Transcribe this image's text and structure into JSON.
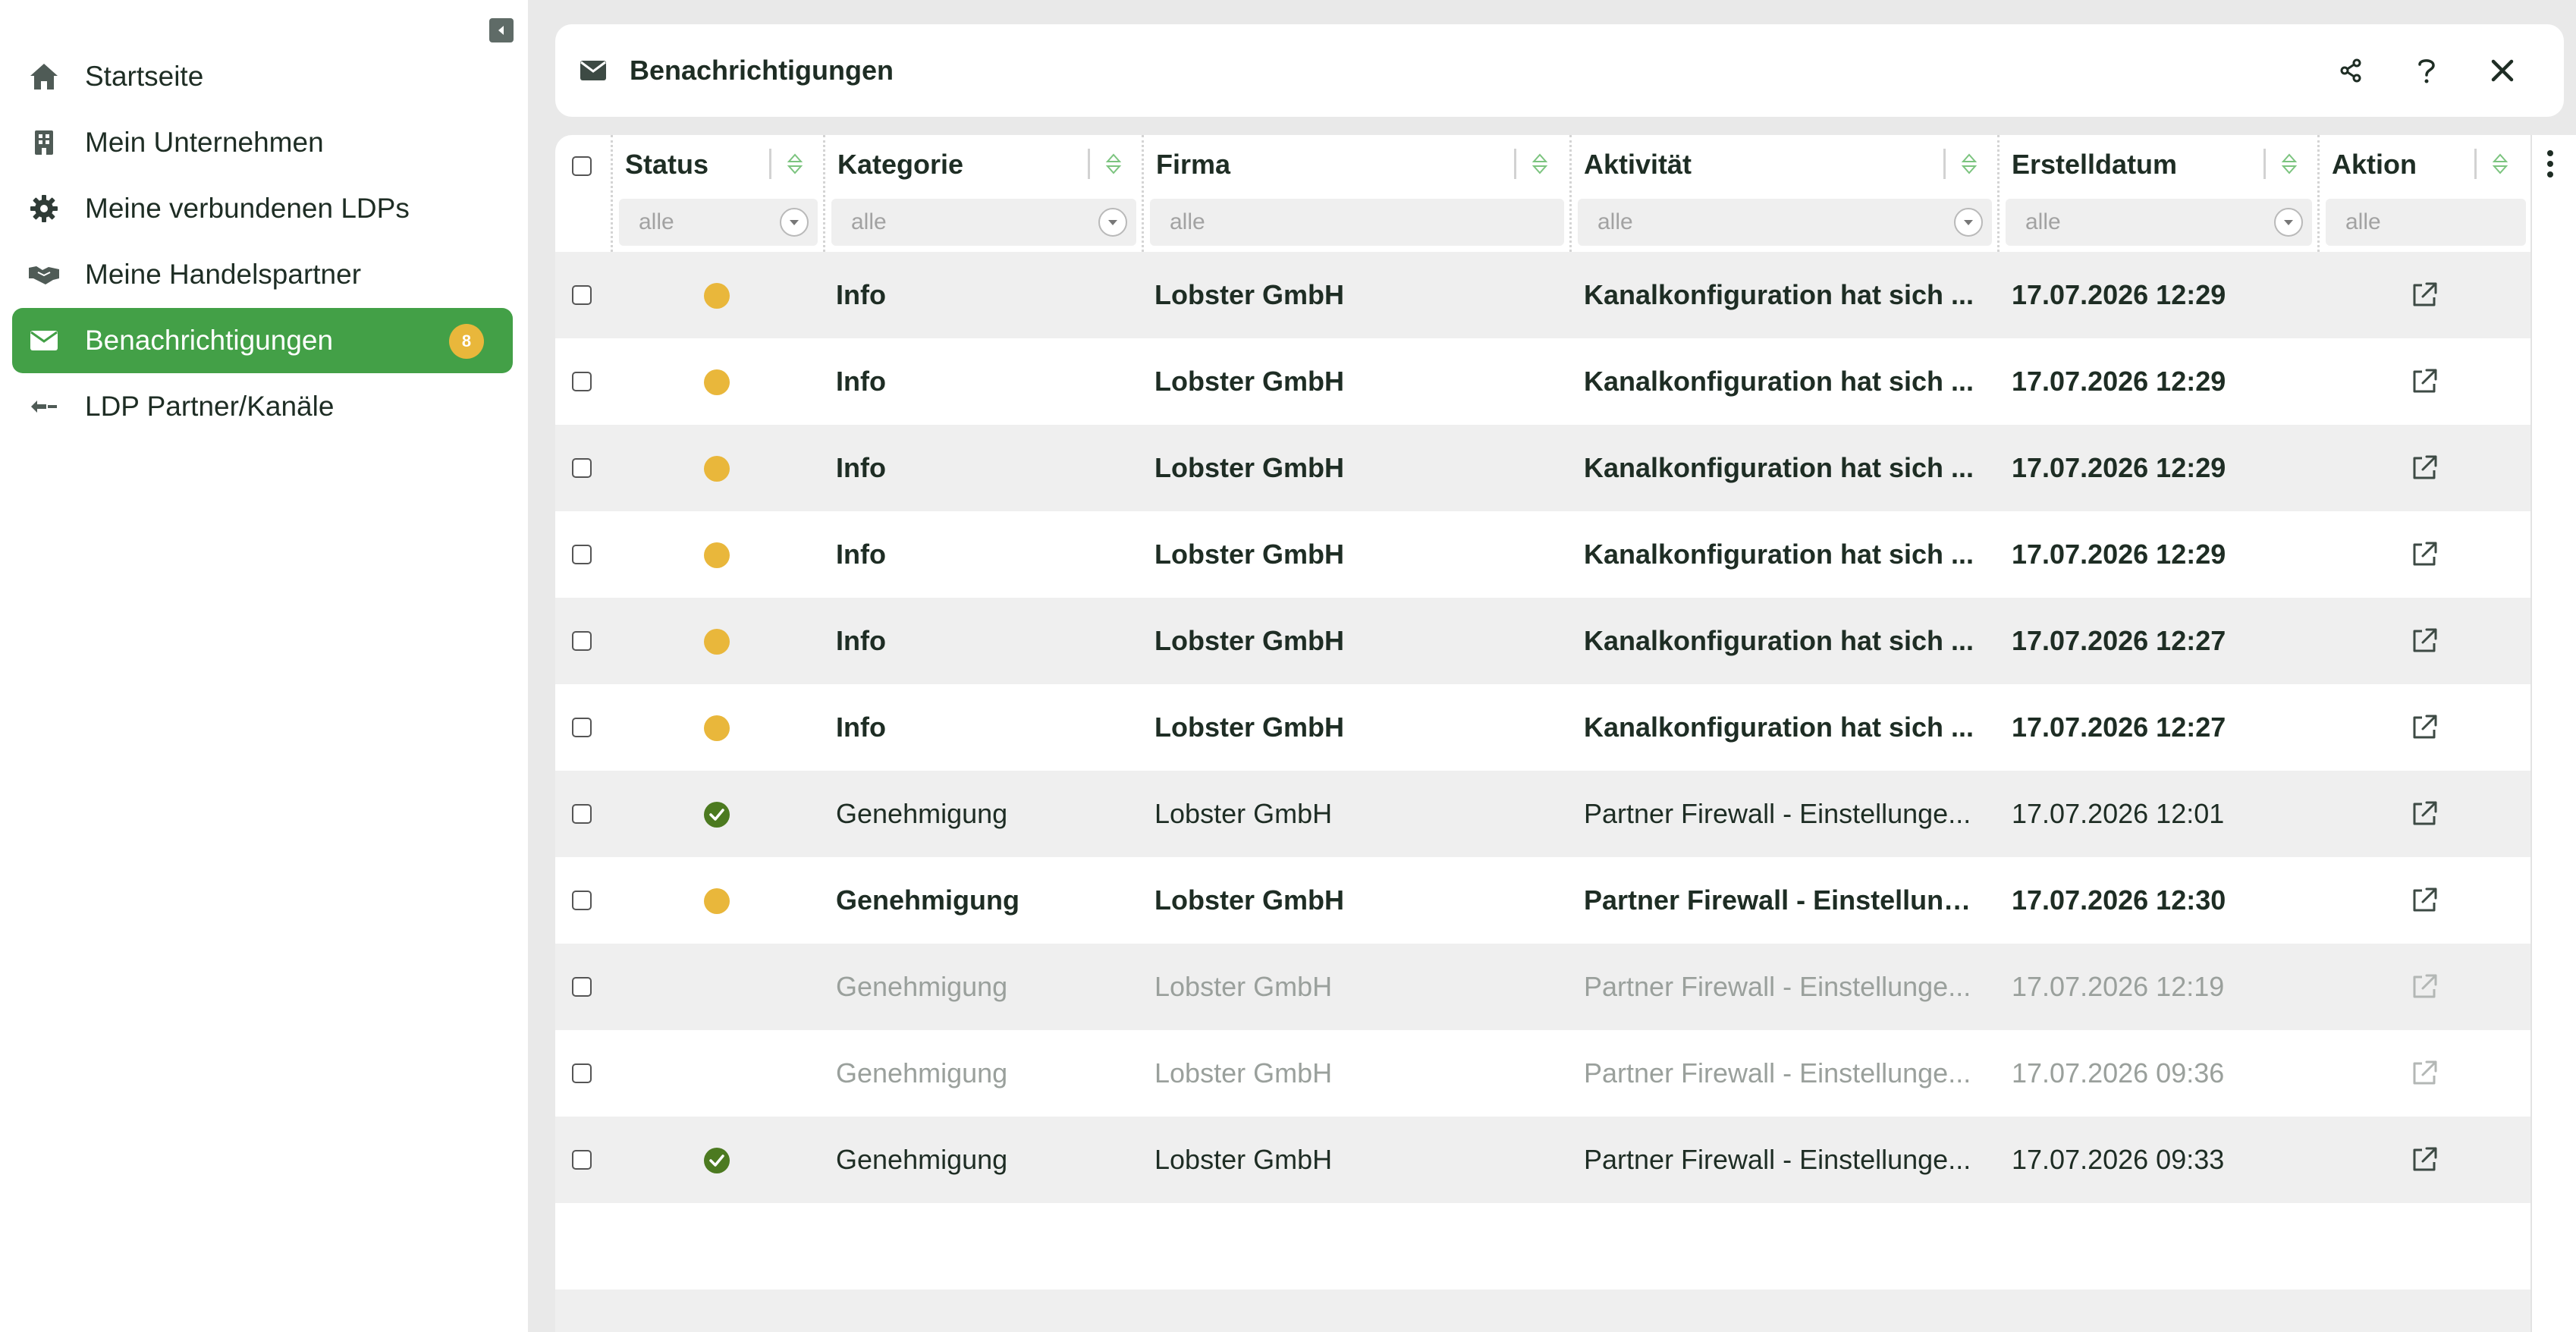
{
  "sidebar": {
    "items": [
      {
        "label": "Startseite",
        "icon": "home-icon"
      },
      {
        "label": "Mein Unternehmen",
        "icon": "building-icon"
      },
      {
        "label": "Meine verbundenen LDPs",
        "icon": "gear-icon"
      },
      {
        "label": "Meine Handelspartner",
        "icon": "handshake-icon"
      },
      {
        "label": "Benachrichtigungen",
        "icon": "mail-icon",
        "active": true,
        "badge": "8"
      },
      {
        "label": "LDP Partner/Kanäle",
        "icon": "arrows-icon"
      }
    ]
  },
  "header": {
    "title": "Benachrichtigungen"
  },
  "table": {
    "columns": [
      "Status",
      "Kategorie",
      "Firma",
      "Aktivität",
      "Erstelldatum",
      "Aktion"
    ],
    "filter_placeholder": "alle",
    "rows": [
      {
        "status": "pending",
        "kategorie": "Info",
        "firma": "Lobster GmbH",
        "aktivitaet": "Kanalkonfiguration hat sich ...",
        "datum": "17.07.2026 12:29",
        "style": "unread"
      },
      {
        "status": "pending",
        "kategorie": "Info",
        "firma": "Lobster GmbH",
        "aktivitaet": "Kanalkonfiguration hat sich ...",
        "datum": "17.07.2026 12:29",
        "style": "unread"
      },
      {
        "status": "pending",
        "kategorie": "Info",
        "firma": "Lobster GmbH",
        "aktivitaet": "Kanalkonfiguration hat sich ...",
        "datum": "17.07.2026 12:29",
        "style": "unread"
      },
      {
        "status": "pending",
        "kategorie": "Info",
        "firma": "Lobster GmbH",
        "aktivitaet": "Kanalkonfiguration hat sich ...",
        "datum": "17.07.2026 12:29",
        "style": "unread"
      },
      {
        "status": "pending",
        "kategorie": "Info",
        "firma": "Lobster GmbH",
        "aktivitaet": "Kanalkonfiguration hat sich ...",
        "datum": "17.07.2026 12:27",
        "style": "unread"
      },
      {
        "status": "pending",
        "kategorie": "Info",
        "firma": "Lobster GmbH",
        "aktivitaet": "Kanalkonfiguration hat sich ...",
        "datum": "17.07.2026 12:27",
        "style": "unread"
      },
      {
        "status": "approved",
        "kategorie": "Genehmigung",
        "firma": "Lobster GmbH",
        "aktivitaet": "Partner Firewall - Einstellunge...",
        "datum": "17.07.2026 12:01",
        "style": "read"
      },
      {
        "status": "pending",
        "kategorie": "Genehmigung",
        "firma": "Lobster GmbH",
        "aktivitaet": "Partner Firewall - Einstellung...",
        "datum": "17.07.2026 12:30",
        "style": "unread"
      },
      {
        "status": "none",
        "kategorie": "Genehmigung",
        "firma": "Lobster GmbH",
        "aktivitaet": "Partner Firewall - Einstellunge...",
        "datum": "17.07.2026 12:19",
        "style": "muted"
      },
      {
        "status": "none",
        "kategorie": "Genehmigung",
        "firma": "Lobster GmbH",
        "aktivitaet": "Partner Firewall - Einstellunge...",
        "datum": "17.07.2026 09:36",
        "style": "muted"
      },
      {
        "status": "approved",
        "kategorie": "Genehmigung",
        "firma": "Lobster GmbH",
        "aktivitaet": "Partner Firewall - Einstellunge...",
        "datum": "17.07.2026 09:33",
        "style": "read"
      }
    ]
  },
  "colors": {
    "accent": "#43a047",
    "badge": "#e9b73b",
    "approved": "#4c7a20",
    "text": "#1e2d24"
  }
}
